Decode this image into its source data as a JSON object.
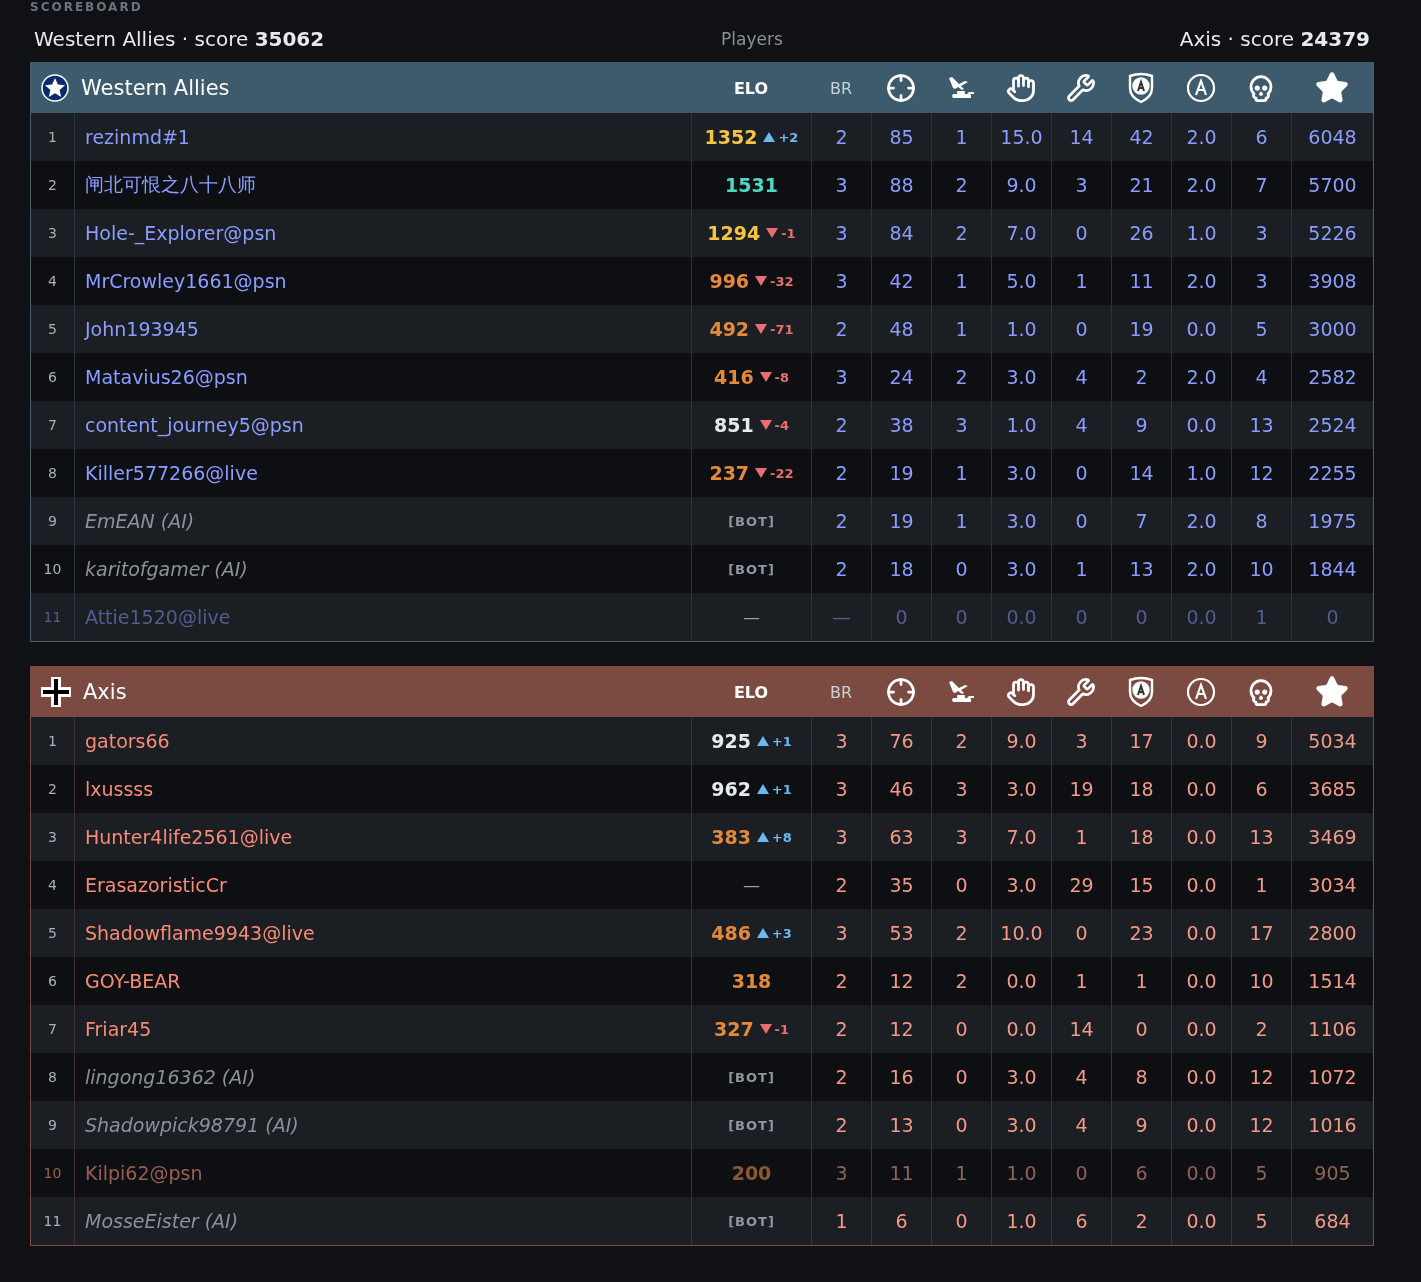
{
  "section_label": "SCOREBOARD",
  "summary": {
    "left": "Western Allies · score **35062**",
    "center": "Players",
    "right": "Axis · score **24379**"
  },
  "teams": [
    {
      "name": "Western Allies",
      "kind": "allies",
      "header_labels": [
        "ELO",
        "BR"
      ],
      "rows": [
        {
          "rank": "1",
          "name": "rezinmd#1",
          "ai": false,
          "dimmed": false,
          "elo": {
            "kind": "rising",
            "value": "1352",
            "color": "#f5c542",
            "delta": "+2"
          },
          "stats": [
            "2",
            "85",
            "1",
            "15.0",
            "14",
            "42",
            "2.0",
            "6",
            "6048"
          ]
        },
        {
          "rank": "2",
          "name": "闸北可恨之八十八师",
          "ai": false,
          "dimmed": false,
          "elo": {
            "kind": "steady",
            "value": "1531",
            "color": "#4fd8c4"
          },
          "stats": [
            "3",
            "88",
            "2",
            "9.0",
            "3",
            "21",
            "2.0",
            "7",
            "5700"
          ]
        },
        {
          "rank": "3",
          "name": "Hole-_Explorer@psn",
          "ai": false,
          "dimmed": false,
          "elo": {
            "kind": "falling",
            "value": "1294",
            "color": "#f5c542",
            "delta": "-1"
          },
          "stats": [
            "3",
            "84",
            "2",
            "7.0",
            "0",
            "26",
            "1.0",
            "3",
            "5226"
          ]
        },
        {
          "rank": "4",
          "name": "MrCrowley1661@psn",
          "ai": false,
          "dimmed": false,
          "elo": {
            "kind": "falling",
            "value": "996",
            "color": "#e38a3a",
            "delta": "-32"
          },
          "stats": [
            "3",
            "42",
            "1",
            "5.0",
            "1",
            "11",
            "2.0",
            "3",
            "3908"
          ]
        },
        {
          "rank": "5",
          "name": "John193945",
          "ai": false,
          "dimmed": false,
          "elo": {
            "kind": "falling",
            "value": "492",
            "color": "#e38a3a",
            "delta": "-71"
          },
          "stats": [
            "2",
            "48",
            "1",
            "1.0",
            "0",
            "19",
            "0.0",
            "5",
            "3000"
          ]
        },
        {
          "rank": "6",
          "name": "Matavius26@psn",
          "ai": false,
          "dimmed": false,
          "elo": {
            "kind": "falling",
            "value": "416",
            "color": "#e38a3a",
            "delta": "-8"
          },
          "stats": [
            "3",
            "24",
            "2",
            "3.0",
            "4",
            "2",
            "2.0",
            "4",
            "2582"
          ]
        },
        {
          "rank": "7",
          "name": "content_journey5@psn",
          "ai": false,
          "dimmed": false,
          "elo": {
            "kind": "falling",
            "value": "851",
            "color": "#e6e9ee",
            "delta": "-4"
          },
          "stats": [
            "2",
            "38",
            "3",
            "1.0",
            "4",
            "9",
            "0.0",
            "13",
            "2524"
          ]
        },
        {
          "rank": "8",
          "name": "Killer577266@live",
          "ai": false,
          "dimmed": false,
          "elo": {
            "kind": "falling",
            "value": "237",
            "color": "#e38a3a",
            "delta": "-22"
          },
          "stats": [
            "2",
            "19",
            "1",
            "3.0",
            "0",
            "14",
            "1.0",
            "12",
            "2255"
          ]
        },
        {
          "rank": "9",
          "name": "EmEAN (AI)",
          "ai": true,
          "dimmed": false,
          "elo": {
            "kind": "bot",
            "value": "[BOT]"
          },
          "stats": [
            "2",
            "19",
            "1",
            "3.0",
            "0",
            "7",
            "2.0",
            "8",
            "1975"
          ]
        },
        {
          "rank": "10",
          "name": "karitofgamer (AI)",
          "ai": true,
          "dimmed": false,
          "elo": {
            "kind": "bot",
            "value": "[BOT]"
          },
          "stats": [
            "2",
            "18",
            "0",
            "3.0",
            "1",
            "13",
            "2.0",
            "10",
            "1844"
          ]
        },
        {
          "rank": "11",
          "name": "Attie1520@live",
          "ai": false,
          "dimmed": true,
          "elo": {
            "kind": "none",
            "value": "—"
          },
          "stats": [
            "—",
            "0",
            "0",
            "0.0",
            "0",
            "0",
            "0.0",
            "1",
            "0"
          ]
        }
      ]
    },
    {
      "name": "Axis",
      "kind": "axis",
      "header_labels": [
        "ELO",
        "BR"
      ],
      "rows": [
        {
          "rank": "1",
          "name": "gators66",
          "ai": false,
          "dimmed": false,
          "elo": {
            "kind": "rising",
            "value": "925",
            "color": "#e6e9ee",
            "delta": "+1"
          },
          "stats": [
            "3",
            "76",
            "2",
            "9.0",
            "3",
            "17",
            "0.0",
            "9",
            "5034"
          ]
        },
        {
          "rank": "2",
          "name": "lxussss",
          "ai": false,
          "dimmed": false,
          "elo": {
            "kind": "rising",
            "value": "962",
            "color": "#e6e9ee",
            "delta": "+1"
          },
          "stats": [
            "3",
            "46",
            "3",
            "3.0",
            "19",
            "18",
            "0.0",
            "6",
            "3685"
          ]
        },
        {
          "rank": "3",
          "name": "Hunter4life2561@live",
          "ai": false,
          "dimmed": false,
          "elo": {
            "kind": "rising",
            "value": "383",
            "color": "#e38a3a",
            "delta": "+8"
          },
          "stats": [
            "3",
            "63",
            "3",
            "7.0",
            "1",
            "18",
            "0.0",
            "13",
            "3469"
          ]
        },
        {
          "rank": "4",
          "name": "ErasazoristicCr",
          "ai": false,
          "dimmed": false,
          "elo": {
            "kind": "none",
            "value": "—"
          },
          "stats": [
            "2",
            "35",
            "0",
            "3.0",
            "29",
            "15",
            "0.0",
            "1",
            "3034"
          ]
        },
        {
          "rank": "5",
          "name": "Shadowflame9943@live",
          "ai": false,
          "dimmed": false,
          "elo": {
            "kind": "rising",
            "value": "486",
            "color": "#e38a3a",
            "delta": "+3"
          },
          "stats": [
            "3",
            "53",
            "2",
            "10.0",
            "0",
            "23",
            "0.0",
            "17",
            "2800"
          ]
        },
        {
          "rank": "6",
          "name": "GOY-BEAR",
          "ai": false,
          "dimmed": false,
          "elo": {
            "kind": "steady",
            "value": "318",
            "color": "#e38a3a"
          },
          "stats": [
            "2",
            "12",
            "2",
            "0.0",
            "1",
            "1",
            "0.0",
            "10",
            "1514"
          ]
        },
        {
          "rank": "7",
          "name": "Friar45",
          "ai": false,
          "dimmed": false,
          "elo": {
            "kind": "falling",
            "value": "327",
            "color": "#e38a3a",
            "delta": "-1"
          },
          "stats": [
            "2",
            "12",
            "0",
            "0.0",
            "14",
            "0",
            "0.0",
            "2",
            "1106"
          ]
        },
        {
          "rank": "8",
          "name": "lingong16362 (AI)",
          "ai": true,
          "dimmed": false,
          "elo": {
            "kind": "bot",
            "value": "[BOT]"
          },
          "stats": [
            "2",
            "16",
            "0",
            "3.0",
            "4",
            "8",
            "0.0",
            "12",
            "1072"
          ]
        },
        {
          "rank": "9",
          "name": "Shadowpick98791 (AI)",
          "ai": true,
          "dimmed": false,
          "elo": {
            "kind": "bot",
            "value": "[BOT]"
          },
          "stats": [
            "2",
            "13",
            "0",
            "3.0",
            "4",
            "9",
            "0.0",
            "12",
            "1016"
          ]
        },
        {
          "rank": "10",
          "name": "Kilpi62@psn",
          "ai": false,
          "dimmed": true,
          "elo": {
            "kind": "steady",
            "value": "200",
            "color": "#8a5a2e"
          },
          "stats": [
            "3",
            "11",
            "1",
            "1.0",
            "0",
            "6",
            "0.0",
            "5",
            "905"
          ]
        },
        {
          "rank": "11",
          "name": "MosseEister (AI)",
          "ai": true,
          "dimmed": false,
          "elo": {
            "kind": "bot",
            "value": "[BOT]"
          },
          "stats": [
            "1",
            "6",
            "0",
            "1.0",
            "6",
            "2",
            "0.0",
            "5",
            "684"
          ]
        }
      ]
    }
  ]
}
